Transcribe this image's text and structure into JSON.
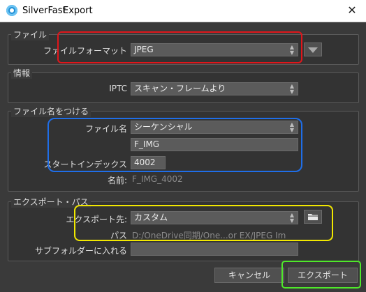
{
  "window": {
    "app_name": "SilverFast",
    "title": "Export",
    "close_glyph": "✕"
  },
  "file_group": {
    "title": "ファイル",
    "format_label": "ファイルフォーマット",
    "format_value": "JPEG"
  },
  "info_group": {
    "title": "情報",
    "iptc_label": "IPTC",
    "iptc_value": "スキャン・フレームより"
  },
  "naming_group": {
    "title": "ファイル名をつける",
    "filename_label": "ファイル名",
    "filename_value": "シーケンシャル",
    "prefix_value": "F_IMG",
    "start_index_label": "スタートインデックス",
    "start_index_value": "4002",
    "name_label": "名前:",
    "name_preview": "F_IMG_4002"
  },
  "export_path_group": {
    "title": "エクスポート・パス",
    "destination_label": "エクスポート先:",
    "destination_value": "カスタム",
    "path_label": "パス",
    "path_value": "D:/OneDrive同期/One...or EX/JPEG Im",
    "subfolder_label": "サブフォルダーに入れる",
    "subfolder_value": ""
  },
  "buttons": {
    "cancel": "キャンセル",
    "export": "エクスポート"
  },
  "icons": {
    "dropdown": "triangle-down-icon",
    "folder": "folder-icon",
    "spinner": "updown-arrows-icon"
  },
  "colors": {
    "highlight_red": "#e0161b",
    "highlight_blue": "#1f6ee8",
    "highlight_yellow": "#f2e800",
    "highlight_green": "#4fe82a"
  }
}
